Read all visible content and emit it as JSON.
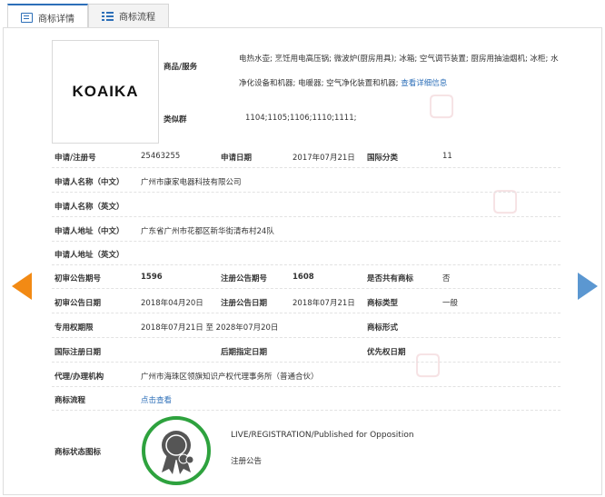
{
  "tabs": [
    {
      "label": "商标详情"
    },
    {
      "label": "商标流程"
    }
  ],
  "logo_text": "KOAIKA",
  "goods": {
    "label": "商品/服务",
    "text": "电热水壶; 烹饪用电高压锅; 微波炉(厨房用具); 冰箱; 空气调节装置; 厨房用抽油烟机; 冰柜; 水净化设备和机器; 电暖器; 空气净化装置和机器;",
    "more": "查看详细信息"
  },
  "similar": {
    "label": "类似群",
    "value": "1104;1105;1106;1110;1111;"
  },
  "fields": {
    "reg_no": {
      "label": "申请/注册号",
      "value": "25463255"
    },
    "apply_date": {
      "label": "申请日期",
      "value": "2017年07月21日"
    },
    "intl_class": {
      "label": "国际分类",
      "value": "11"
    },
    "applicant_cn": {
      "label": "申请人名称（中文）",
      "value": "广州市康家电器科技有限公司"
    },
    "applicant_en": {
      "label": "申请人名称（英文）",
      "value": ""
    },
    "address_cn": {
      "label": "申请人地址（中文）",
      "value": "广东省广州市花都区新华街清布村24队"
    },
    "address_en": {
      "label": "申请人地址（英文）",
      "value": ""
    },
    "prelim_issue": {
      "label": "初审公告期号",
      "value": "1596"
    },
    "reg_issue": {
      "label": "注册公告期号",
      "value": "1608"
    },
    "shared": {
      "label": "是否共有商标",
      "value": "否"
    },
    "prelim_date": {
      "label": "初审公告日期",
      "value": "2018年04月20日"
    },
    "reg_date": {
      "label": "注册公告日期",
      "value": "2018年07月21日"
    },
    "mark_type": {
      "label": "商标类型",
      "value": "一般"
    },
    "exclusive": {
      "label": "专用权期限",
      "value": "2018年07月21日 至 2028年07月20日"
    },
    "mark_form": {
      "label": "商标形式",
      "value": ""
    },
    "intl_reg_date": {
      "label": "国际注册日期",
      "value": ""
    },
    "later_date": {
      "label": "后期指定日期",
      "value": ""
    },
    "priority_date": {
      "label": "优先权日期",
      "value": ""
    },
    "agent": {
      "label": "代理/办理机构",
      "value": "广州市海珠区领旗知识产权代理事务所（普通合伙）"
    },
    "flow": {
      "label": "商标流程",
      "value": "点击查看"
    },
    "status": {
      "label": "商标状态图标",
      "value_en": "LIVE/REGISTRATION/Published for Opposition",
      "value_cn": "注册公告"
    }
  },
  "colors": {
    "accent": "#2d6fb8",
    "prev_arrow": "#f28a14",
    "next_arrow": "#5b97d1",
    "status_ring": "#2ea23e",
    "watermark": "#f6e2e4"
  }
}
